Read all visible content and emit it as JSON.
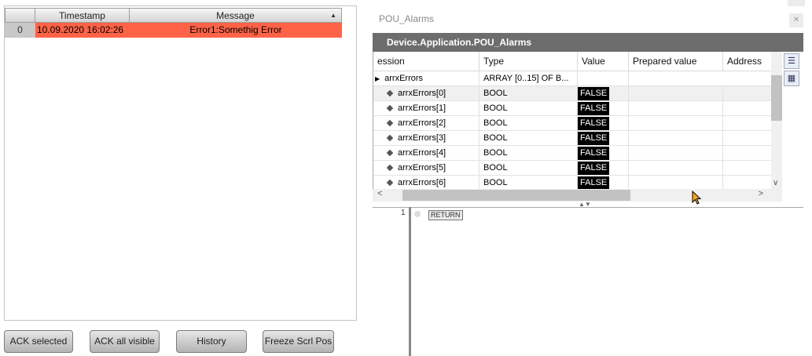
{
  "alarm_table": {
    "columns": [
      "",
      "Timestamp",
      "Message"
    ],
    "rows": [
      {
        "index": "0",
        "timestamp": "10.09.2020 16:02:26",
        "message": "Error1:Somethig Error"
      }
    ],
    "row_color": "#ff6347"
  },
  "buttons": {
    "ack_selected": "ACK selected",
    "ack_all_visible": "ACK all visible",
    "history": "History",
    "freeze_scroll": "Freeze Scrl Pos"
  },
  "watch": {
    "window_title": "POU_Alarms",
    "banner": "Device.Application.POU_Alarms",
    "columns": [
      "ession",
      "Type",
      "Value",
      "Prepared value",
      "Address"
    ],
    "parent": {
      "name": "arrxErrors",
      "type": "ARRAY [0..15] OF B..."
    },
    "rows": [
      {
        "name": "arrxErrors[0]",
        "type": "BOOL",
        "value": "FALSE"
      },
      {
        "name": "arrxErrors[1]",
        "type": "BOOL",
        "value": "FALSE"
      },
      {
        "name": "arrxErrors[2]",
        "type": "BOOL",
        "value": "FALSE"
      },
      {
        "name": "arrxErrors[3]",
        "type": "BOOL",
        "value": "FALSE"
      },
      {
        "name": "arrxErrors[4]",
        "type": "BOOL",
        "value": "FALSE"
      },
      {
        "name": "arrxErrors[5]",
        "type": "BOOL",
        "value": "FALSE"
      },
      {
        "name": "arrxErrors[6]",
        "type": "BOOL",
        "value": "FALSE"
      }
    ]
  },
  "editor": {
    "line_number": "1",
    "keyword": "RETURN"
  }
}
